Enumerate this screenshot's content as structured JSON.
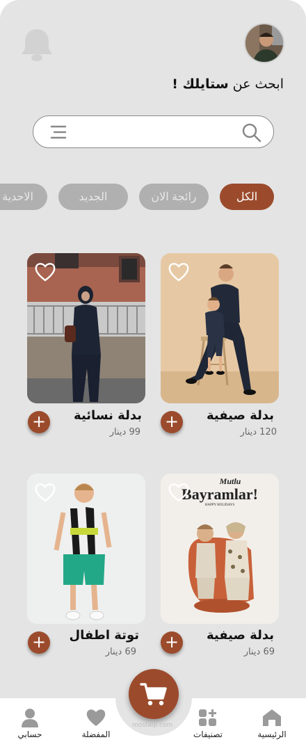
{
  "header": {
    "headline_prefix": "ابحث عن",
    "headline_bold": "ستايلك !"
  },
  "search": {
    "value": "",
    "placeholder": ""
  },
  "categories": [
    {
      "label": "الكل",
      "active": true
    },
    {
      "label": "رائجة الان",
      "active": false
    },
    {
      "label": "الجديد",
      "active": false
    },
    {
      "label": "الاحدية",
      "active": false
    }
  ],
  "products": [
    {
      "title": "بدلة صيفية",
      "price": "120 دينار"
    },
    {
      "title": "بدلة نسائية",
      "price": "99 دينار"
    },
    {
      "title": "بدلة صيفية",
      "price": "69 دينار"
    },
    {
      "title": "توتة اطفال",
      "price": "69 دينار"
    }
  ],
  "poster": {
    "line1": "Mutlu",
    "line2": "Bayramlar!",
    "line3": "HAPPY HOLIDAYS"
  },
  "nav": [
    {
      "label": "الرئيسية",
      "icon": "home-icon"
    },
    {
      "label": "تصنيفات",
      "icon": "categories-icon"
    },
    {
      "label": "المفضلة",
      "icon": "heart-icon"
    },
    {
      "label": "حسابي",
      "icon": "user-icon"
    }
  ],
  "watermark": "mostaql.com",
  "colors": {
    "accent": "#9b4b2c",
    "background": "#e4e4e4",
    "chip_inactive": "#b0b0b0"
  }
}
